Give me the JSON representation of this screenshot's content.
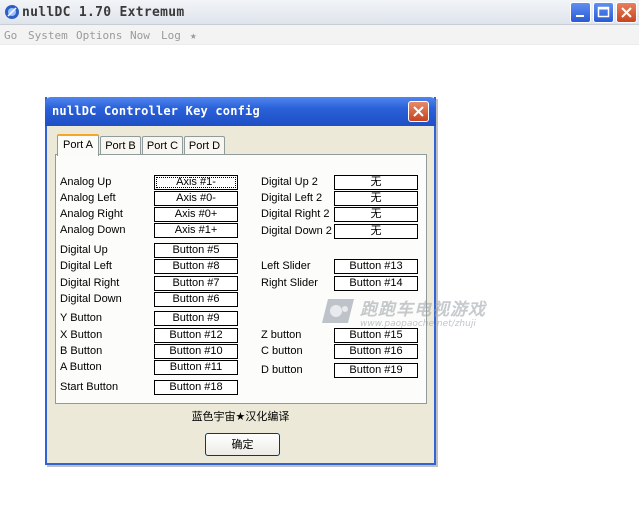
{
  "app": {
    "title": "nullDC 1.70 Extremum",
    "menu": [
      "Go",
      "System",
      "Options",
      "Now",
      "Log",
      "★"
    ]
  },
  "dialog": {
    "title": "nullDC Controller Key config",
    "tabs": [
      "Port A",
      "Port B",
      "Port C",
      "Port D"
    ],
    "active_tab": "Port A",
    "left_column": [
      {
        "label": "Analog Up",
        "value": "Axis #1-"
      },
      {
        "label": "Analog Left",
        "value": "Axis #0-"
      },
      {
        "label": "Analog Right",
        "value": "Axis #0+"
      },
      {
        "label": "Analog Down",
        "value": "Axis #1+"
      },
      {
        "label": "Digital Up",
        "value": "Button #5"
      },
      {
        "label": "Digital Left",
        "value": "Button #8"
      },
      {
        "label": "Digital Right",
        "value": "Button #7"
      },
      {
        "label": "Digital Down",
        "value": "Button #6"
      },
      {
        "label": "Y Button",
        "value": "Button #9"
      },
      {
        "label": "X Button",
        "value": "Button #12"
      },
      {
        "label": "B Button",
        "value": "Button #10"
      },
      {
        "label": "A Button",
        "value": "Button #11"
      },
      {
        "label": "Start  Button",
        "value": "Button #18"
      }
    ],
    "right_column": [
      {
        "label": "Digital Up 2",
        "value": "无"
      },
      {
        "label": "Digital Left 2",
        "value": "无"
      },
      {
        "label": "Digital Right 2",
        "value": "无"
      },
      {
        "label": "Digital Down 2",
        "value": "无"
      },
      {
        "label": "Left Slider",
        "value": "Button #13"
      },
      {
        "label": "Right Slider",
        "value": "Button #14"
      },
      {
        "label": "Z button",
        "value": "Button #15"
      },
      {
        "label": "C button",
        "value": "Button #16"
      },
      {
        "label": "D button",
        "value": "Button #19"
      }
    ],
    "footer_text": "蓝色宇宙★汉化编译",
    "ok_label": "确定"
  },
  "watermark": {
    "text": "跑跑车电视游戏",
    "url": "www.paopaoche.net/zhuji"
  },
  "colors": {
    "dialog_title_blue": "#2a60d8",
    "active_tab_accent": "#f6a72a",
    "close_red": "#c5431f"
  }
}
